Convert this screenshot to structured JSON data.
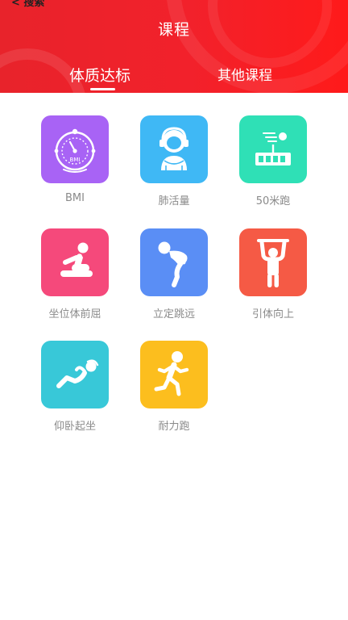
{
  "status_bar": {
    "back_text": "< 搜索"
  },
  "header": {
    "title": "课程",
    "tabs": [
      {
        "label": "体质达标",
        "active": true
      },
      {
        "label": "其他课程",
        "active": false
      }
    ],
    "background_color": "#f0222b"
  },
  "courses": [
    {
      "label": "BMI",
      "icon": "bmi-gauge-icon",
      "color": "#a863f5",
      "tile_text": "BMI"
    },
    {
      "label": "肺活量",
      "icon": "spirometer-person-icon",
      "color": "#3fb8f5"
    },
    {
      "label": "50米跑",
      "icon": "sprint-track-icon",
      "color": "#2fe0b6"
    },
    {
      "label": "坐位体前屈",
      "icon": "sit-and-reach-icon",
      "color": "#f5497b"
    },
    {
      "label": "立定跳远",
      "icon": "standing-jump-icon",
      "color": "#5a8ef5"
    },
    {
      "label": "引体向上",
      "icon": "pull-up-icon",
      "color": "#f55a45"
    },
    {
      "label": "仰卧起坐",
      "icon": "sit-up-icon",
      "color": "#38c8d8"
    },
    {
      "label": "耐力跑",
      "icon": "running-figure-icon",
      "color": "#fcbe1e"
    }
  ]
}
